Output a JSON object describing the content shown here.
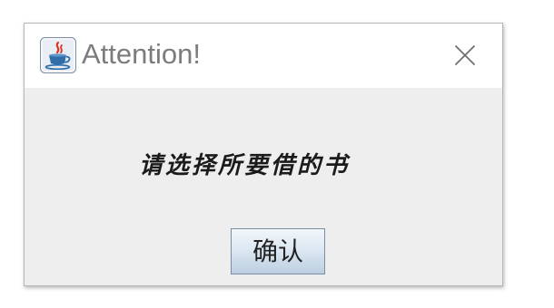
{
  "dialog": {
    "title": "Attention!",
    "icon": "java-coffee-cup-icon",
    "close_icon": "close-icon",
    "message": "请选择所要借的书",
    "confirm_label": "确认"
  },
  "colors": {
    "title_text": "#7c7c7c",
    "content_background": "#eeeeee",
    "titlebar_background": "#ffffff",
    "button_gradient_top": "#f2f6fa",
    "button_gradient_bottom": "#bccfe1"
  }
}
